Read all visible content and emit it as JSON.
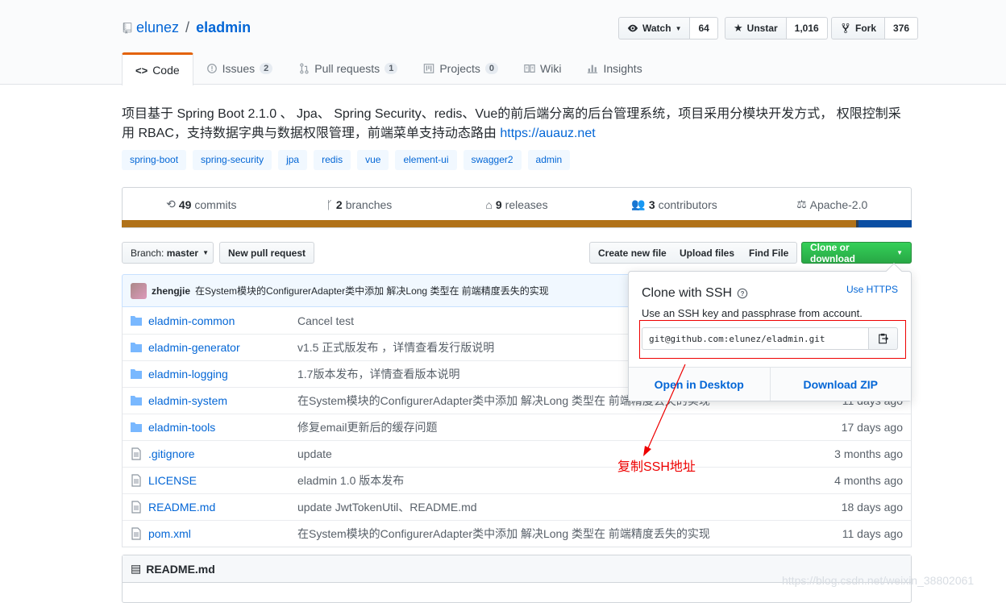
{
  "header": {
    "owner": "elunez",
    "separator": "/",
    "repo": "eladmin",
    "watch": {
      "label": "Watch",
      "count": "64"
    },
    "star": {
      "label": "Unstar",
      "count": "1,016"
    },
    "fork": {
      "label": "Fork",
      "count": "376"
    }
  },
  "tabs": [
    {
      "label": "Code",
      "icon": "code-icon"
    },
    {
      "label": "Issues",
      "count": "2",
      "icon": "issue-icon"
    },
    {
      "label": "Pull requests",
      "count": "1",
      "icon": "pull-request-icon"
    },
    {
      "label": "Projects",
      "count": "0",
      "icon": "project-icon"
    },
    {
      "label": "Wiki",
      "icon": "book-icon"
    },
    {
      "label": "Insights",
      "icon": "graph-icon"
    }
  ],
  "description": {
    "text": "项目基于 Spring Boot 2.1.0 、 Jpa、 Spring Security、redis、Vue的前后端分离的后台管理系统，项目采用分模块开发方式， 权限控制采用 RBAC，支持数据字典与数据权限管理，前端菜单支持动态路由",
    "link": "https://auauz.net"
  },
  "topics": [
    "spring-boot",
    "spring-security",
    "jpa",
    "redis",
    "vue",
    "element-ui",
    "swagger2",
    "admin"
  ],
  "summary": {
    "commits": {
      "count": "49",
      "label": "commits"
    },
    "branches": {
      "count": "2",
      "label": "branches"
    },
    "releases": {
      "count": "9",
      "label": "releases"
    },
    "contributors": {
      "count": "3",
      "label": "contributors"
    },
    "license": "Apache-2.0"
  },
  "language_colors": [
    "#b07219",
    "#2c3e50",
    "#0b4ea2"
  ],
  "file_nav": {
    "branch_prefix": "Branch:",
    "branch": "master",
    "new_pr": "New pull request",
    "create_file": "Create new file",
    "upload_files": "Upload files",
    "find_file": "Find File",
    "clone": "Clone or download"
  },
  "commit": {
    "author": "zhengjie",
    "message": "在System模块的ConfigurerAdapter类中添加 解决Long 类型在 前端精度丢失的实现"
  },
  "files": [
    {
      "type": "dir",
      "name": "eladmin-common",
      "message": "Cancel test",
      "age": ""
    },
    {
      "type": "dir",
      "name": "eladmin-generator",
      "message": "v1.5 正式版发布 ，详情查看发行版说明",
      "age": ""
    },
    {
      "type": "dir",
      "name": "eladmin-logging",
      "message": "1.7版本发布，详情查看版本说明",
      "age": ""
    },
    {
      "type": "dir",
      "name": "eladmin-system",
      "message": "在System模块的ConfigurerAdapter类中添加 解决Long 类型在 前端精度丢失的实现",
      "age": "11 days ago"
    },
    {
      "type": "dir",
      "name": "eladmin-tools",
      "message": "修复email更新后的缓存问题",
      "age": "17 days ago"
    },
    {
      "type": "file",
      "name": ".gitignore",
      "message": "update",
      "age": "3 months ago"
    },
    {
      "type": "file",
      "name": "LICENSE",
      "message": "eladmin 1.0 版本发布",
      "age": "4 months ago"
    },
    {
      "type": "file",
      "name": "README.md",
      "message": "update JwtTokenUtil、README.md",
      "age": "18 days ago"
    },
    {
      "type": "file",
      "name": "pom.xml",
      "message": "在System模块的ConfigurerAdapter类中添加 解决Long 类型在 前端精度丢失的实现",
      "age": "11 days ago"
    }
  ],
  "readme": {
    "title": "README.md"
  },
  "clone_popup": {
    "title": "Clone with SSH",
    "switch": "Use HTTPS",
    "subtitle": "Use an SSH key and passphrase from account.",
    "url": "git@github.com:elunez/eladmin.git",
    "open_desktop": "Open in Desktop",
    "download_zip": "Download ZIP"
  },
  "annotation": "复制SSH地址",
  "watermark": "https://blog.csdn.net/weixin_38802061"
}
